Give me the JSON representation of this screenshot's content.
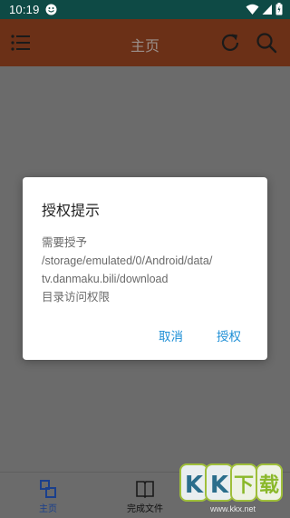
{
  "status_bar": {
    "time": "10:19"
  },
  "toolbar": {
    "title": "主页"
  },
  "dialog": {
    "title": "授权提示",
    "message_lines": [
      "需要授予",
      "/storage/emulated/0/Android/data/",
      "tv.danmaku.bili/download",
      "目录访问权限"
    ],
    "cancel_label": "取消",
    "confirm_label": "授权"
  },
  "bottom_nav": {
    "items": [
      {
        "label": "主页",
        "active": true
      },
      {
        "label": "完成文件",
        "active": false
      }
    ]
  },
  "watermark": {
    "text": "KK下载",
    "url": "www.kkx.net"
  },
  "colors": {
    "status_bar": "#0e4a45",
    "toolbar": "#6b3017",
    "scrim": "#6b6b6b",
    "accent": "#1e8fd6",
    "nav_active": "#1a3f8c"
  }
}
